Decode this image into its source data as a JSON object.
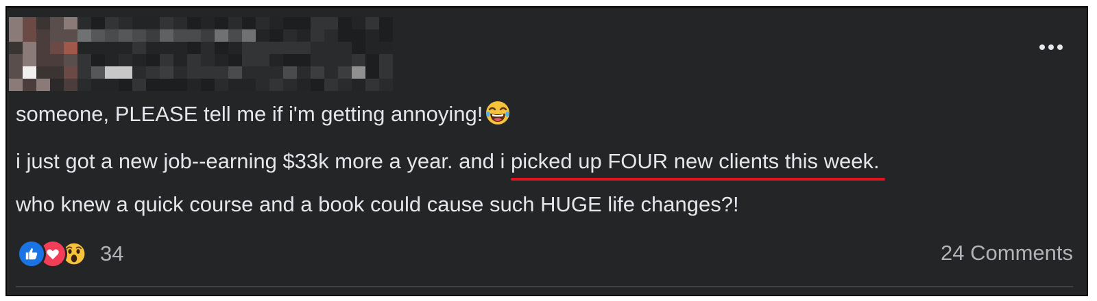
{
  "post": {
    "lines": [
      "someone, PLEASE tell me if i'm getting annoying!",
      "i just got a new job--earning $33k more a year. and i ",
      "picked up FOUR new clients this week.",
      "who knew a quick course and a book could cause such HUGE life changes?!"
    ],
    "emoji": "laughing-crying-emoji"
  },
  "header": {
    "author": "blurred",
    "more_icon": "more-options-icon"
  },
  "reactions": {
    "types": [
      "like",
      "love",
      "wow"
    ],
    "count": "34"
  },
  "comments": {
    "label": "24 Comments"
  },
  "colors": {
    "background": "#242526",
    "text": "#e4e6eb",
    "muted": "#b0b3b8",
    "underline": "#e2131e",
    "like": "#1b74e4",
    "love": "#f33e58"
  }
}
